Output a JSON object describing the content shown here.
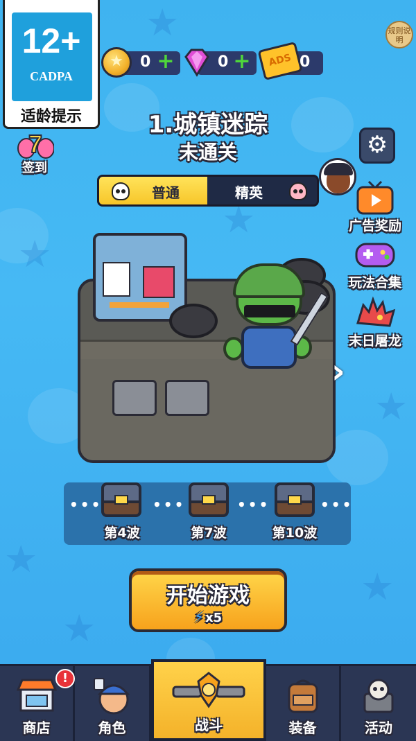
{
  "age_rating": {
    "number": "12+",
    "org": "CADPA",
    "label": "适龄提示"
  },
  "rules_button": {
    "label": "规则说明"
  },
  "currencies": [
    {
      "icon": "gold-coin-icon",
      "value": "0"
    },
    {
      "icon": "gem-icon",
      "value": "0"
    },
    {
      "icon": "ads-ticket-icon",
      "value": "0",
      "icon_text": "ADS"
    }
  ],
  "sign_in": {
    "label": "签到",
    "day": "7"
  },
  "level": {
    "title": "1.城镇迷踪",
    "status": "未通关"
  },
  "mode_switch": {
    "normal": "普通",
    "elite": "精英",
    "selected": "普通"
  },
  "side_buttons": [
    {
      "label": "广告奖励",
      "icon": "tv-icon"
    },
    {
      "label": "玩法合集",
      "icon": "gamepad-icon"
    },
    {
      "label": "末日屠龙",
      "icon": "dragon-icon"
    }
  ],
  "waves": [
    {
      "label": "第4波"
    },
    {
      "label": "第7波"
    },
    {
      "label": "第10波"
    }
  ],
  "start_button": {
    "label": "开始游戏",
    "cost": "x5",
    "cost_icon": "energy-bolt-icon"
  },
  "nav": [
    {
      "label": "商店",
      "icon": "shop-icon",
      "badge": "!"
    },
    {
      "label": "角色",
      "icon": "character-icon"
    },
    {
      "label": "战斗",
      "icon": "battle-icon",
      "active": true
    },
    {
      "label": "装备",
      "icon": "backpack-icon"
    },
    {
      "label": "活动",
      "icon": "event-icon"
    }
  ],
  "colors": {
    "accent": "#f7b52a",
    "sky": "#40b1ef",
    "panel": "#2b3654"
  }
}
